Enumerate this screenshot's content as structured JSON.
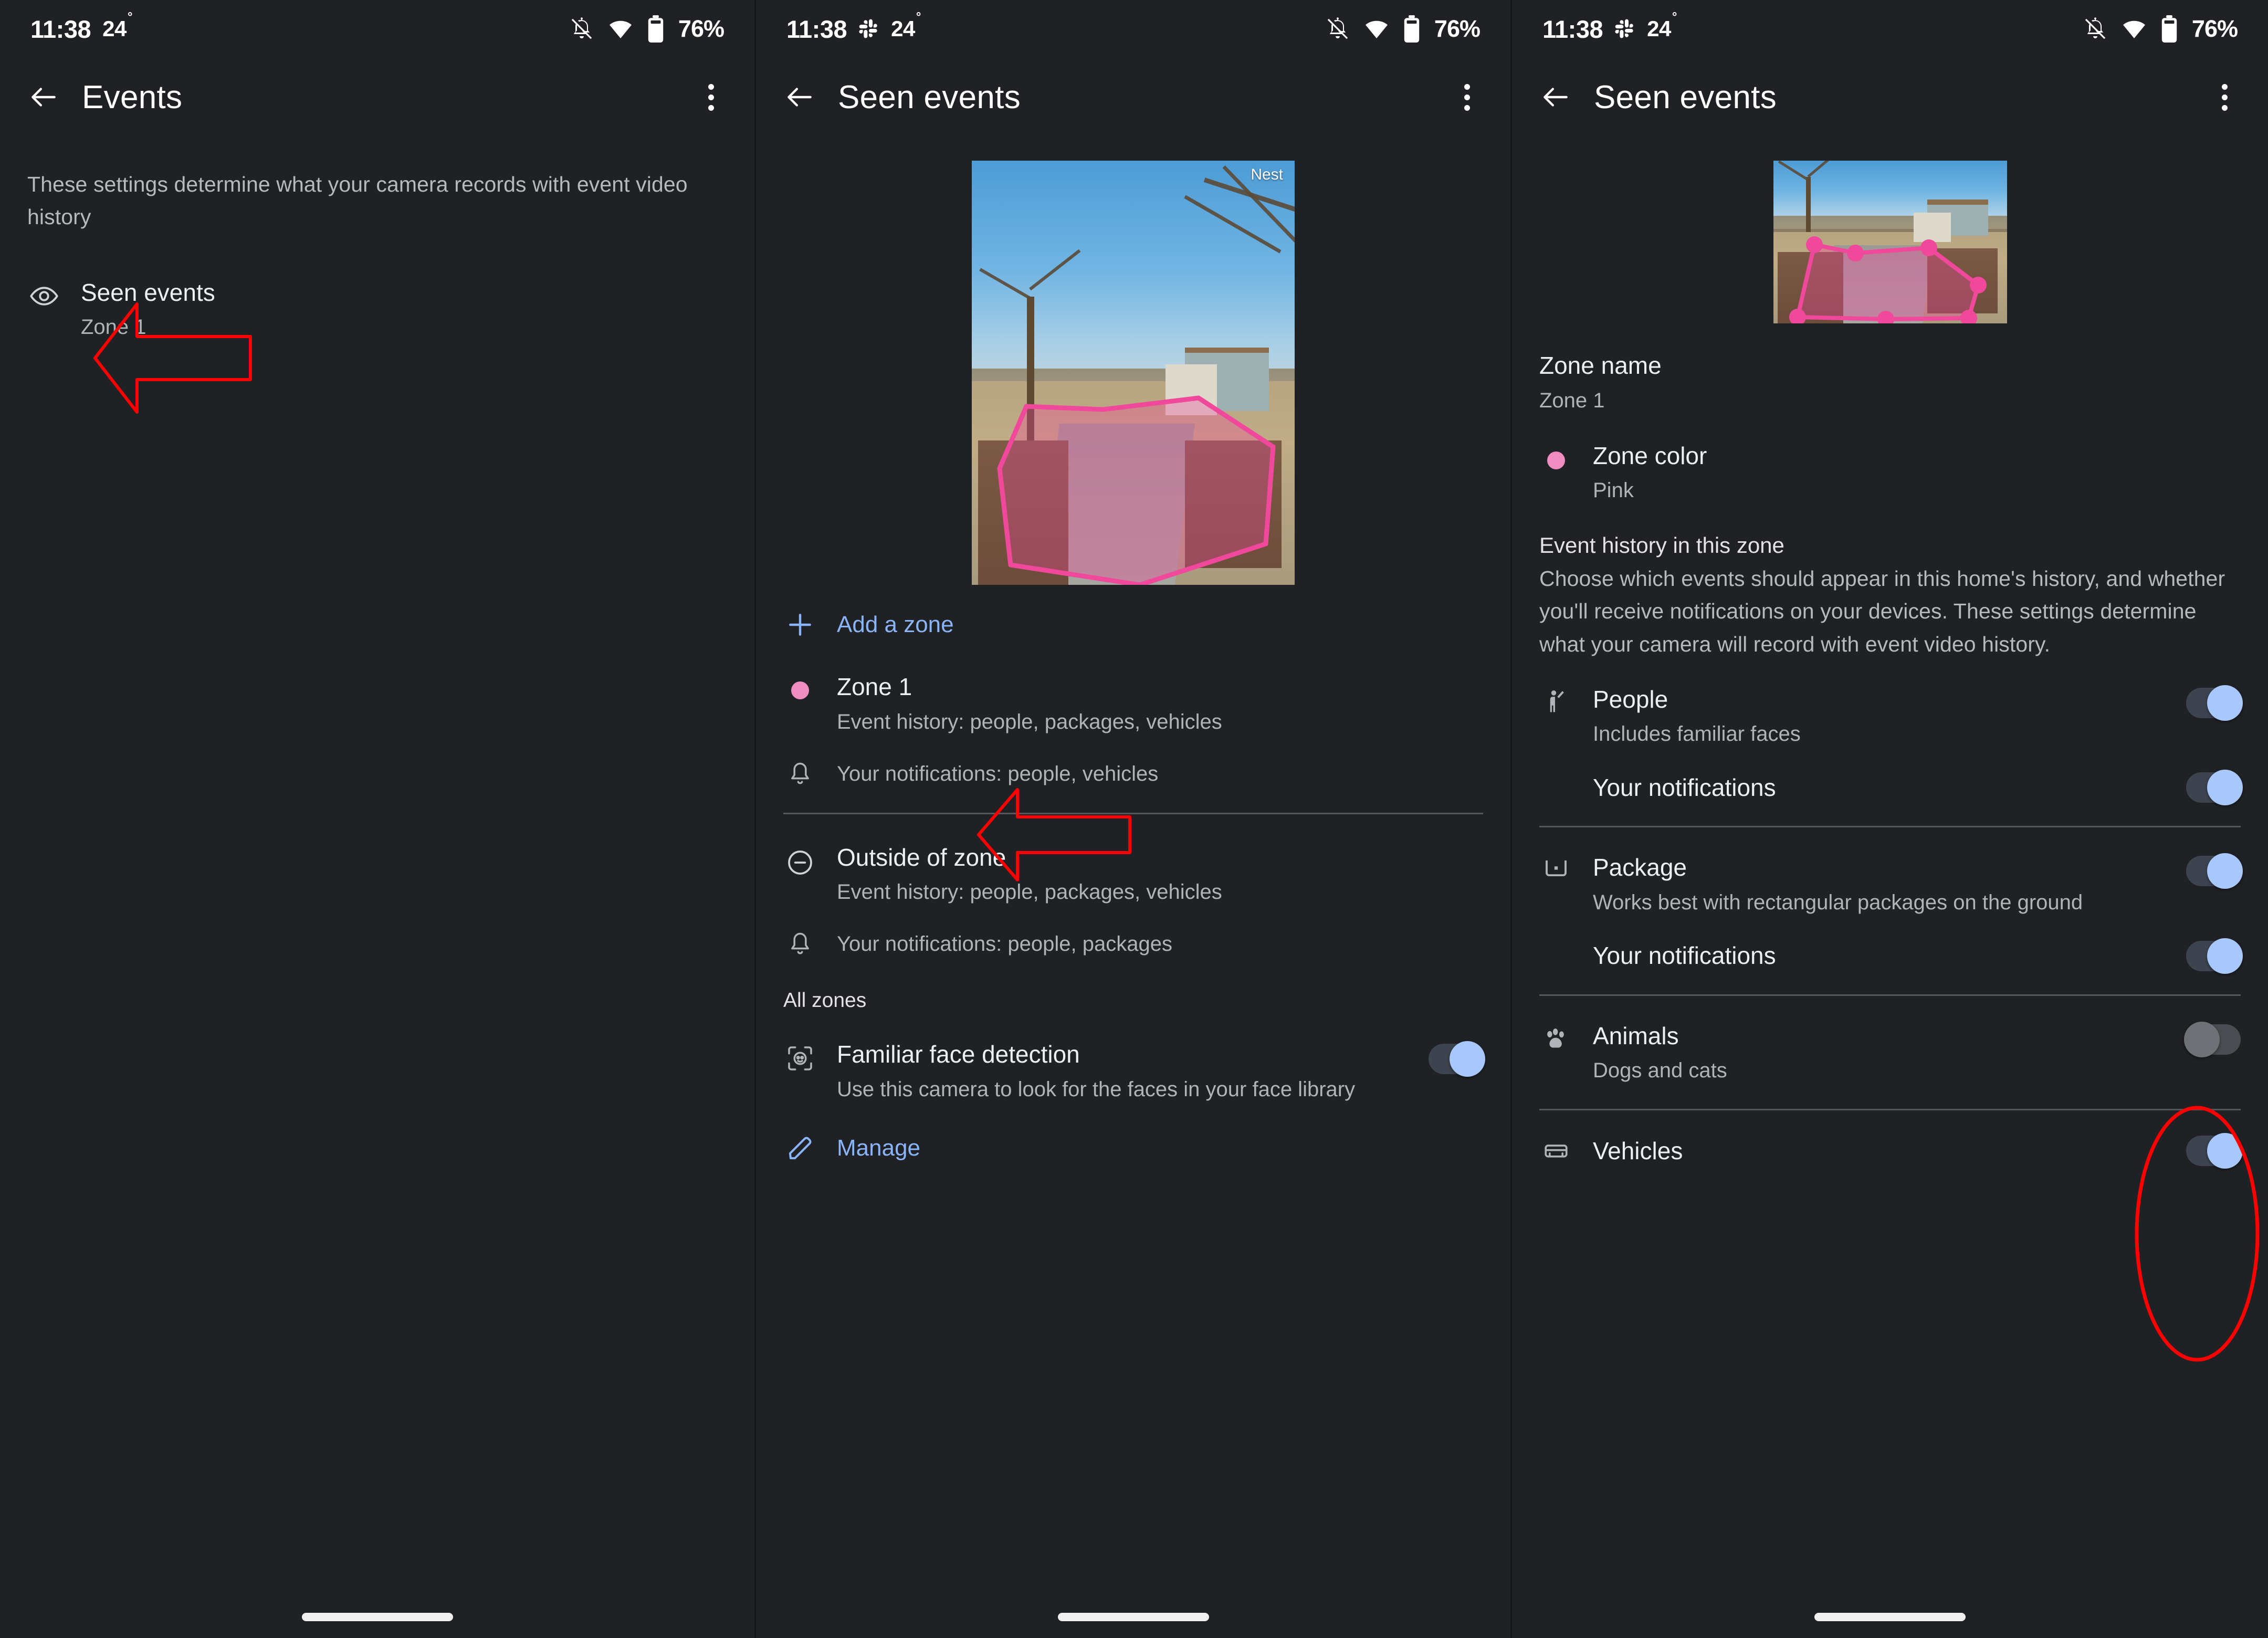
{
  "status_bar": {
    "time": "11:38",
    "temperature": "24",
    "degree": "°",
    "battery_percent": "76%",
    "icons": [
      "slack-icon",
      "notifications-off-icon",
      "wifi-icon",
      "battery-icon"
    ]
  },
  "colors": {
    "accent_link": "#8ab4f8",
    "zone_pink": "#f0499b",
    "zone_dot_pink": "#f08cc0",
    "toggle_on": "#a8c7fa",
    "toggle_off": "#6e7175",
    "annotation_red": "#ff0000",
    "background": "#1f2125"
  },
  "panel1": {
    "appbar": {
      "title": "Events",
      "back": "back-arrow",
      "overflow": "more-options"
    },
    "description": "These settings determine what your camera records with event video history",
    "items": [
      {
        "icon": "eye-icon",
        "title": "Seen events",
        "subtitle": "Zone 1"
      }
    ],
    "annotation": "red-arrow-pointing-left-at-seen-events"
  },
  "panel2": {
    "appbar": {
      "title": "Seen events",
      "back": "back-arrow",
      "overflow": "more-options"
    },
    "camera": {
      "watermark": "Nest",
      "zone_shape": "pink-polygon"
    },
    "add_zone": {
      "icon": "plus-icon",
      "label": "Add a zone"
    },
    "zones": [
      {
        "icon": "zone-color-dot",
        "title": "Zone 1",
        "event_history": "Event history: people, packages, vehicles",
        "notifications_icon": "bell-icon",
        "notifications": "Your notifications: people, vehicles"
      },
      {
        "icon": "minus-circle-icon",
        "title": "Outside of zone",
        "event_history": "Event history: people, packages, vehicles",
        "notifications_icon": "bell-icon",
        "notifications": "Your notifications: people, packages"
      }
    ],
    "all_zones_label": "All zones",
    "familiar_face": {
      "icon": "face-scan-icon",
      "title": "Familiar face detection",
      "subtitle": "Use this camera to look for the faces in your face library",
      "enabled": true
    },
    "manage": {
      "icon": "pencil-icon",
      "label": "Manage"
    },
    "annotation": "red-arrow-pointing-left-at-your-notifications"
  },
  "panel3": {
    "appbar": {
      "title": "Seen events",
      "back": "back-arrow",
      "overflow": "more-options"
    },
    "camera": {
      "zone_shape": "pink-polygon-with-handles"
    },
    "zone_name": {
      "label": "Zone name",
      "value": "Zone 1"
    },
    "zone_color": {
      "label": "Zone color",
      "value": "Pink",
      "swatch": "pink-dot"
    },
    "event_history_heading": "Event history in this zone",
    "event_history_description": "Choose which events should appear in this home's history, and whether you'll receive notifications on your devices. These settings determine what your camera will record with event video history.",
    "settings": [
      {
        "icon": "person-waving-icon",
        "title": "People",
        "subtitle": "Includes familiar faces",
        "enabled": true,
        "notifications_label": "Your notifications",
        "notifications_enabled": true
      },
      {
        "icon": "package-icon",
        "title": "Package",
        "subtitle": "Works best with rectangular packages on the ground",
        "enabled": true,
        "notifications_label": "Your notifications",
        "notifications_enabled": true
      },
      {
        "icon": "paw-icon",
        "title": "Animals",
        "subtitle": "Dogs and cats",
        "enabled": false
      },
      {
        "icon": "car-icon",
        "title": "Vehicles",
        "subtitle": "",
        "enabled": true
      }
    ],
    "annotation": "red-ellipse-around-package-toggles"
  }
}
